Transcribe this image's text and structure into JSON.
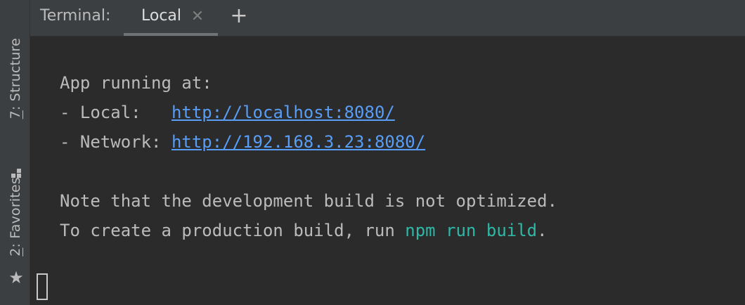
{
  "sidebar": {
    "structure": {
      "number": "7",
      "label": ": Structure",
      "icon": "structure-icon"
    },
    "favorites": {
      "number": "2",
      "label": ": Favorites",
      "icon": "star-icon"
    }
  },
  "header": {
    "title": "Terminal:",
    "tab": {
      "label": "Local",
      "close_icon": "close-icon"
    },
    "add_icon": "plus-icon"
  },
  "terminal": {
    "line1": "App running at:",
    "line2_prefix": "- Local:   ",
    "line2_link": "http://localhost:8080/",
    "line3_prefix": "- Network: ",
    "line3_link": "http://192.168.3.23:8080/",
    "line4": "Note that the development build is not optimized.",
    "line5_prefix": "To create a production build, run ",
    "line5_cmd": "npm run build",
    "line5_suffix": "."
  },
  "colors": {
    "background": "#2b2b2b",
    "panel": "#3c3f41",
    "text": "#bbbbbb",
    "link": "#589df6",
    "command": "#2eb8a6"
  }
}
